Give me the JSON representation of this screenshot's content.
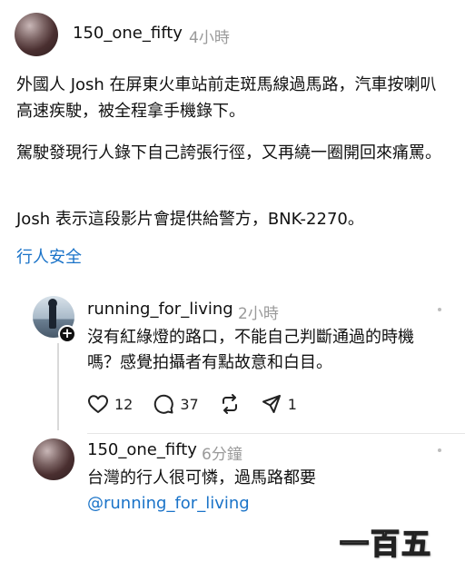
{
  "post": {
    "username": "150_one_fifty",
    "time": "4小時",
    "paragraphs": [
      "外國人 Josh 在屏東火車站前走斑馬線過馬路，汽車按喇叭高速疾駛，被全程拿手機錄下。",
      "駕駛發現行人錄下自己誇張行徑，又再繞一圈開回來痛罵。",
      "Josh 表示這段影片會提供給警方，BNK-2270。"
    ],
    "tag": "行人安全"
  },
  "reply1": {
    "username": "running_for_living",
    "time": "2小時",
    "text": "沒有紅綠燈的路口，不能自己判斷通過的時機嗎？感覺拍攝者有點故意和白目。",
    "actions": {
      "likes": "12",
      "comments": "37",
      "shares": "1"
    }
  },
  "reply2": {
    "username": "150_one_fifty",
    "time": "6分鐘",
    "text": "台灣的行人很可憐，過馬路都要",
    "mention": "@running_for_living"
  },
  "watermark": "一百五",
  "colors": {
    "link": "#1a73c8",
    "secondary_text": "#9a9a9a",
    "divider": "#e6e6e6"
  },
  "icons": [
    "heart-icon",
    "comment-icon",
    "repost-icon",
    "share-icon",
    "more-icon",
    "follow-plus-icon"
  ]
}
